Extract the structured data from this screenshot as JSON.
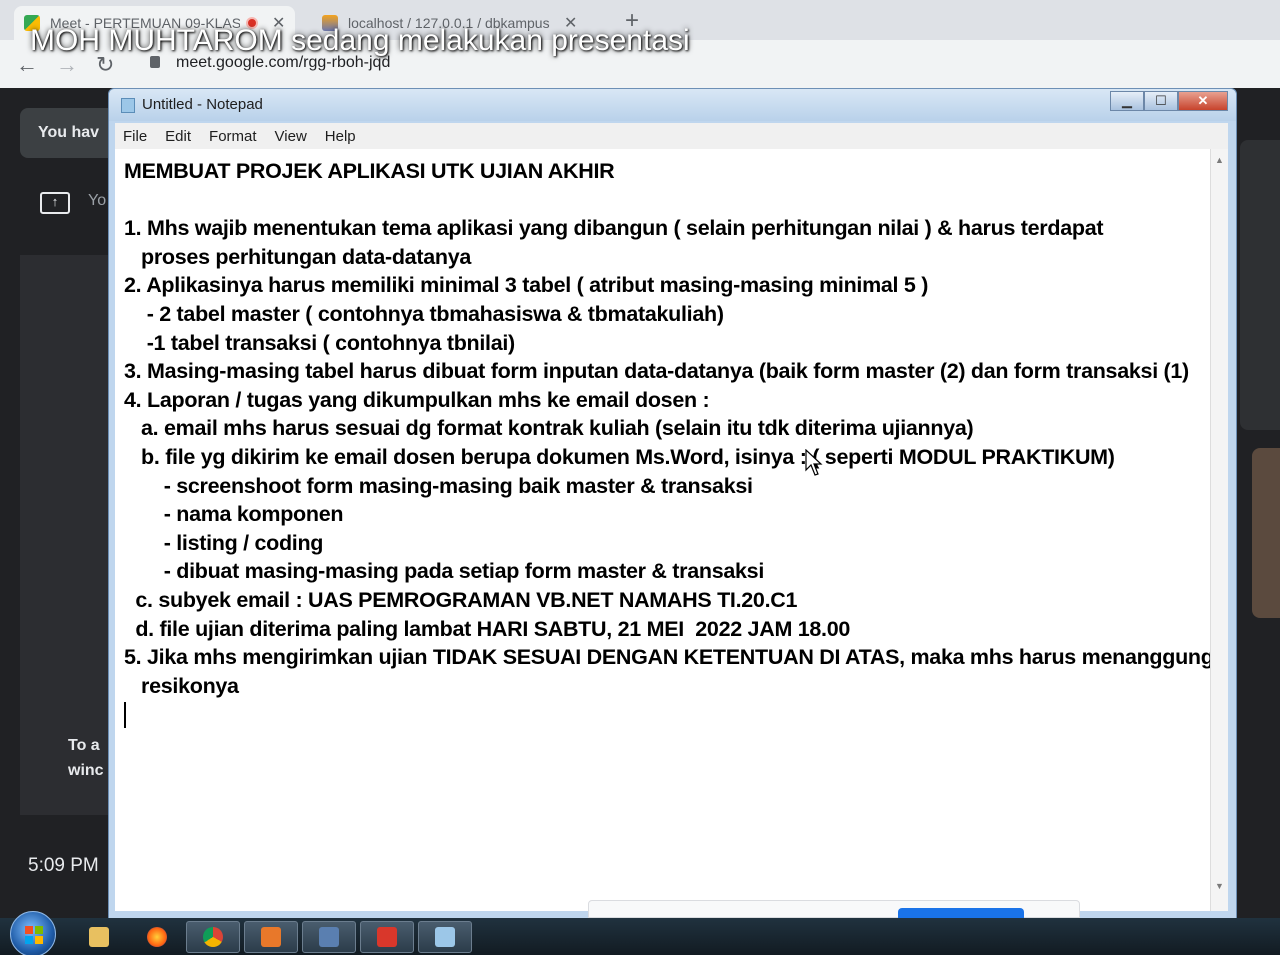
{
  "browser": {
    "tabs": [
      {
        "title": "Meet - PERTEMUAN 09-KLAS",
        "recording": true
      },
      {
        "title": "localhost / 127.0.0.1 / dbkampus"
      }
    ],
    "url": "meet.google.com/rgg-rboh-jqd"
  },
  "banner": "MOH MUHTAROM sedang melakukan presentasi",
  "meet": {
    "notice_label": "You hav",
    "present_label": "Yo",
    "toa_line1": "To a",
    "toa_line2": "winc",
    "clock": "5:09 PM"
  },
  "notepad": {
    "title": "Untitled - Notepad",
    "menu": [
      "File",
      "Edit",
      "Format",
      "View",
      "Help"
    ],
    "lines": [
      "MEMBUAT PROJEK APLIKASI UTK UJIAN AKHIR",
      "",
      "1. Mhs wajib menentukan tema aplikasi yang dibangun ( selain perhitungan nilai ) & harus terdapat",
      "   proses perhitungan data-datanya",
      "2. Aplikasinya harus memiliki minimal 3 tabel ( atribut masing-masing minimal 5 )",
      "    - 2 tabel master ( contohnya tbmahasiswa & tbmatakuliah)",
      "    -1 tabel transaksi ( contohnya tbnilai)",
      "3. Masing-masing tabel harus dibuat form inputan data-datanya (baik form master (2) dan form transaksi (1)",
      "4. Laporan / tugas yang dikumpulkan mhs ke email dosen :",
      "   a. email mhs harus sesuai dg format kontrak kuliah (selain itu tdk diterima ujiannya)",
      "   b. file yg dikirim ke email dosen berupa dokumen Ms.Word, isinya : ( seperti MODUL PRAKTIKUM)",
      "       - screenshoot form masing-masing baik master & transaksi",
      "       - nama komponen",
      "       - listing / coding",
      "       - dibuat masing-masing pada setiap form master & transaksi",
      "  c. subyek email : UAS PEMROGRAMAN VB.NET NAMAHS TI.20.C1",
      "  d. file ujian diterima paling lambat HARI SABTU, 21 MEI  2022 JAM 18.00",
      "5. Jika mhs mengirimkan ujian TIDAK SESUAI DENGAN KETENTUAN DI ATAS, maka mhs harus menanggung",
      "   resikonya"
    ]
  },
  "taskbar": {
    "icons": [
      "explorer-icon",
      "firefox-icon",
      "chrome-icon",
      "app-icon",
      "network-icon",
      "pdf-icon",
      "notepad-icon"
    ]
  }
}
